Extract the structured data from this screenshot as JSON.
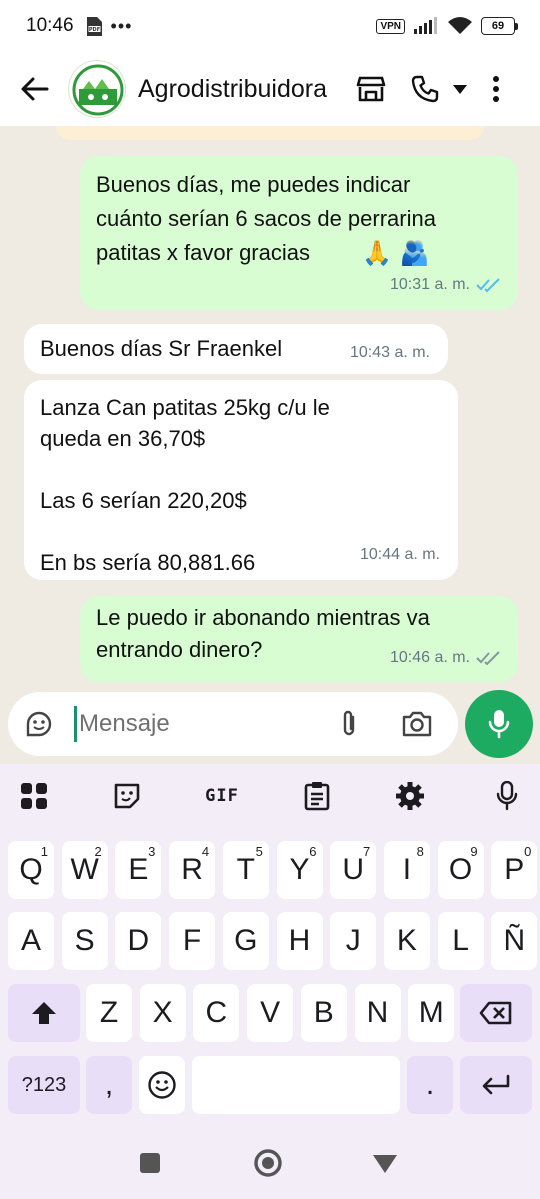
{
  "status_bar": {
    "time": "10:46",
    "left_icons": [
      "pdf-icon",
      "more-icon"
    ],
    "vpn": "VPN",
    "battery": "69"
  },
  "header": {
    "contact_name": "Agrodistribuidora",
    "icons": [
      "back-arrow-icon",
      "avatar",
      "store-icon",
      "phone-icon",
      "caret-down-icon",
      "more-vert-icon"
    ]
  },
  "messages": [
    {
      "direction": "outgoing",
      "text": "Buenos días, me puedes indicar\ncuánto serían 6 sacos de perrarina\npatitas x favor gracias",
      "emojis": "🙏 🫂",
      "time": "10:31 a. m.",
      "status": "read"
    },
    {
      "direction": "incoming",
      "text": "Buenos días Sr Fraenkel",
      "time": "10:43 a. m."
    },
    {
      "direction": "incoming",
      "text": "Lanza Can patitas 25kg c/u le\nqueda en 36,70$\n\nLas 6 serían 220,20$\n\nEn bs sería 80,881.66",
      "time": "10:44 a. m."
    },
    {
      "direction": "outgoing",
      "text": "Le puedo ir abonando mientras va\nentrando dinero?",
      "time": "10:46 a. m.",
      "status": "delivered"
    }
  ],
  "input": {
    "placeholder": "Mensaje"
  },
  "keyboard": {
    "toolbar": [
      "apps-icon",
      "sticker-icon",
      "GIF",
      "clipboard-icon",
      "settings-icon",
      "mic-icon"
    ],
    "gif_label": "GIF",
    "row1": [
      "Q",
      "W",
      "E",
      "R",
      "T",
      "Y",
      "U",
      "I",
      "O",
      "P"
    ],
    "row1_hints": [
      "1",
      "2",
      "3",
      "4",
      "5",
      "6",
      "7",
      "8",
      "9",
      "0"
    ],
    "row2": [
      "A",
      "S",
      "D",
      "F",
      "G",
      "H",
      "J",
      "K",
      "L",
      "Ñ"
    ],
    "row3": [
      "Z",
      "X",
      "C",
      "V",
      "B",
      "N",
      "M"
    ],
    "symbols_label": "?123",
    "comma_label": ",",
    "period_label": "."
  },
  "colors": {
    "outgoing_bubble": "#d9fdd3",
    "incoming_bubble": "#ffffff",
    "chat_background": "#efeae2",
    "read_ticks": "#53bdeb",
    "mic_button": "#1daa61",
    "keyboard_background": "#f3edf7",
    "keyboard_function_key": "#e8def8"
  }
}
